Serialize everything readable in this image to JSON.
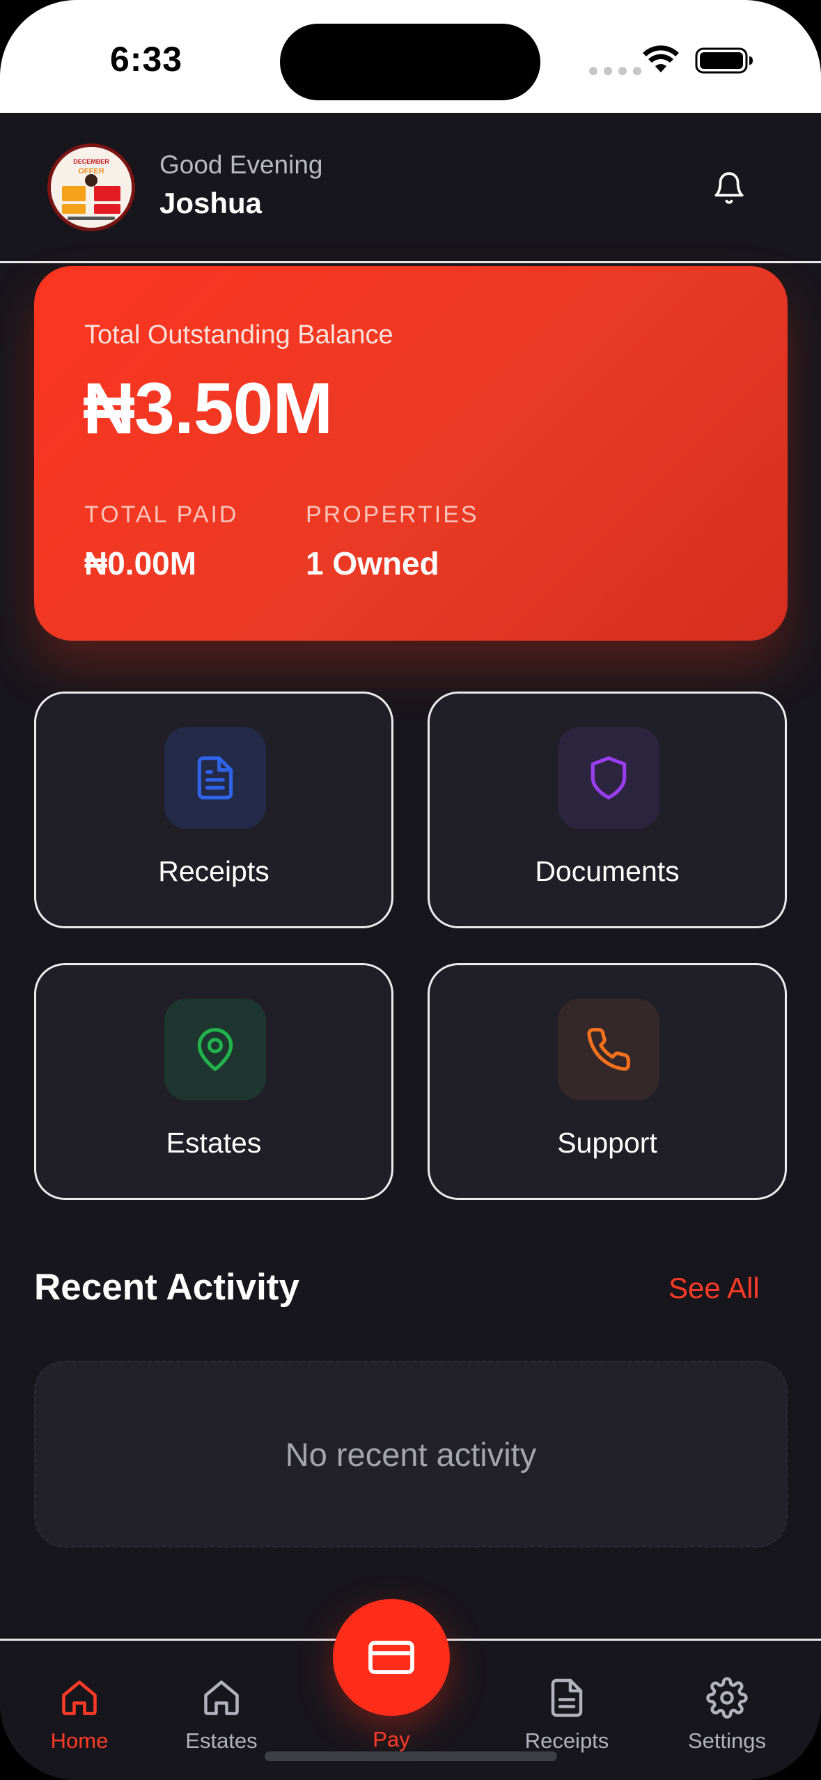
{
  "status_bar": {
    "time": "6:33"
  },
  "header": {
    "greeting": "Good Evening",
    "user_name": "Joshua",
    "avatar_text": "DECEMBER OFFER"
  },
  "balance_card": {
    "label": "Total Outstanding Balance",
    "amount": "₦3.50M",
    "total_paid_label": "TOTAL PAID",
    "total_paid_value": "₦0.00M",
    "properties_label": "PROPERTIES",
    "properties_value": "1 Owned"
  },
  "tiles": [
    {
      "label": "Receipts",
      "icon": "document-icon",
      "color": "#2f64e8"
    },
    {
      "label": "Documents",
      "icon": "shield-icon",
      "color": "#9a3ff0"
    },
    {
      "label": "Estates",
      "icon": "map-pin-icon",
      "color": "#22b34d"
    },
    {
      "label": "Support",
      "icon": "phone-icon",
      "color": "#f4711e"
    }
  ],
  "recent_activity": {
    "title": "Recent Activity",
    "see_all": "See All",
    "empty_text": "No recent activity"
  },
  "bottom_nav": {
    "items": [
      {
        "label": "Home",
        "icon": "home-icon",
        "active": true
      },
      {
        "label": "Estates",
        "icon": "home-icon",
        "active": false
      },
      {
        "label": "Pay",
        "icon": "credit-card-icon",
        "active": false
      },
      {
        "label": "Receipts",
        "icon": "document-icon",
        "active": false
      },
      {
        "label": "Settings",
        "icon": "gear-icon",
        "active": false
      }
    ]
  },
  "colors": {
    "accent": "#ff2d1a",
    "background": "#17161c",
    "tile_background": "#201f28"
  }
}
